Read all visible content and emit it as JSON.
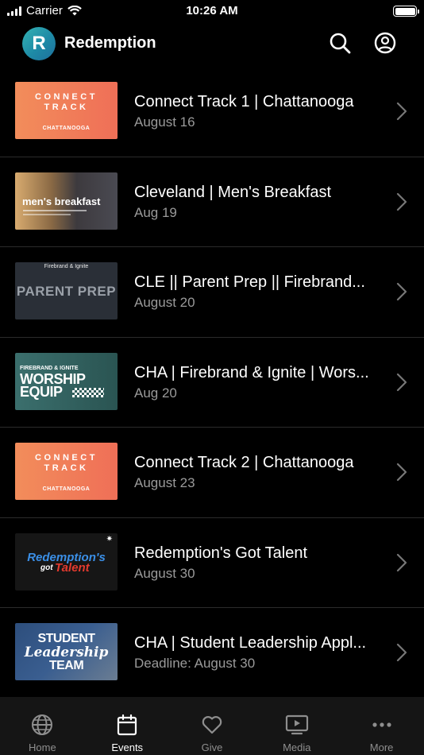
{
  "status_bar": {
    "carrier": "Carrier",
    "time": "10:26 AM"
  },
  "header": {
    "logo_letter": "R",
    "title": "Redemption",
    "search_icon": "search-icon",
    "account_icon": "account-icon"
  },
  "events": [
    {
      "title": "Connect Track 1 | Chattanooga",
      "date": "August 16",
      "thumb": {
        "line1": "CONNECT",
        "line2": "TRACK",
        "line3": "CHATTANOOGA"
      }
    },
    {
      "title": "Cleveland | Men's Breakfast",
      "date": "Aug 19",
      "thumb": {
        "line1": "men's breakfast"
      }
    },
    {
      "title": "CLE || Parent Prep || Firebrand...",
      "date": "August 20",
      "thumb": {
        "line1": "Firebrand & Ignite",
        "line2": "PARENT PREP"
      }
    },
    {
      "title": "CHA | Firebrand & Ignite | Wors...",
      "date": "Aug 20",
      "thumb": {
        "line1": "FIREBRAND & IGNITE",
        "line2": "WORSHIP",
        "line3": "EQUIP"
      }
    },
    {
      "title": "Connect Track 2 | Chattanooga",
      "date": "August 23",
      "thumb": {
        "line1": "CONNECT",
        "line2": "TRACK",
        "line3": "CHATTANOOGA"
      }
    },
    {
      "title": "Redemption's Got Talent",
      "date": "August 30",
      "thumb": {
        "line1": "Redemption's",
        "line2": "got",
        "line3": "Talent"
      }
    },
    {
      "title": "CHA | Student Leadership Appl...",
      "date": "Deadline: August 30",
      "thumb": {
        "line1": "STUDENT",
        "line2": "Leadership",
        "line3": "TEAM"
      }
    }
  ],
  "tabs": [
    {
      "label": "Home",
      "icon": "globe-icon",
      "active": false
    },
    {
      "label": "Events",
      "icon": "calendar-icon",
      "active": true
    },
    {
      "label": "Give",
      "icon": "heart-icon",
      "active": false
    },
    {
      "label": "Media",
      "icon": "tv-play-icon",
      "active": false
    },
    {
      "label": "More",
      "icon": "ellipsis-icon",
      "active": false
    }
  ],
  "colors": {
    "background": "#000000",
    "secondary_text": "#9a9a9a",
    "tab_bar": "#151515",
    "accent_orange": "#f0805a"
  }
}
